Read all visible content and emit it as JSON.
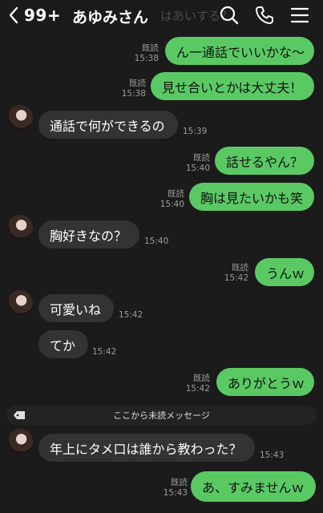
{
  "header": {
    "back_count": "99+",
    "contact_name": "あゆみさん",
    "ghost_text": "はあいする？",
    "icons": [
      "chevron-left-icon",
      "search-icon",
      "phone-icon",
      "menu-icon"
    ]
  },
  "messages": [
    {
      "side": "out",
      "text": "ん一通話でいいかな～",
      "read": "既読",
      "time": "15:38"
    },
    {
      "side": "out",
      "text": "見せ合いとかは大丈夫！",
      "read": "既読",
      "time": "15:38"
    },
    {
      "side": "in",
      "text": "通話で何ができるの",
      "time": "15:39"
    },
    {
      "side": "out",
      "text": "話せるやん？",
      "read": "既読",
      "time": "15:40"
    },
    {
      "side": "out",
      "text": "胸は見たいかも笑",
      "read": "既読",
      "time": "15:40"
    },
    {
      "side": "in",
      "text": "胸好きなの？",
      "time": "15:40"
    },
    {
      "side": "out",
      "text": "うんｗ",
      "read": "既読",
      "time": "15:42"
    },
    {
      "side": "in",
      "text": "可愛いね",
      "time": "15:42"
    },
    {
      "side": "in",
      "text": "てか",
      "time": "15:42"
    },
    {
      "side": "out",
      "text": "ありがとうｗ",
      "read": "既読",
      "time": "15:42"
    },
    {
      "side": "in",
      "text": "年上にタメ口は誰から教わった？",
      "time": "15:43"
    },
    {
      "side": "out",
      "text": "あ、すみませんｗ",
      "read": "既読",
      "time": "15:43"
    }
  ],
  "unread_divider": "ここから未読メッセージ",
  "colors": {
    "background": "#1b1b1b",
    "outgoing_bubble": "#5ac964",
    "incoming_bubble": "#333333"
  }
}
